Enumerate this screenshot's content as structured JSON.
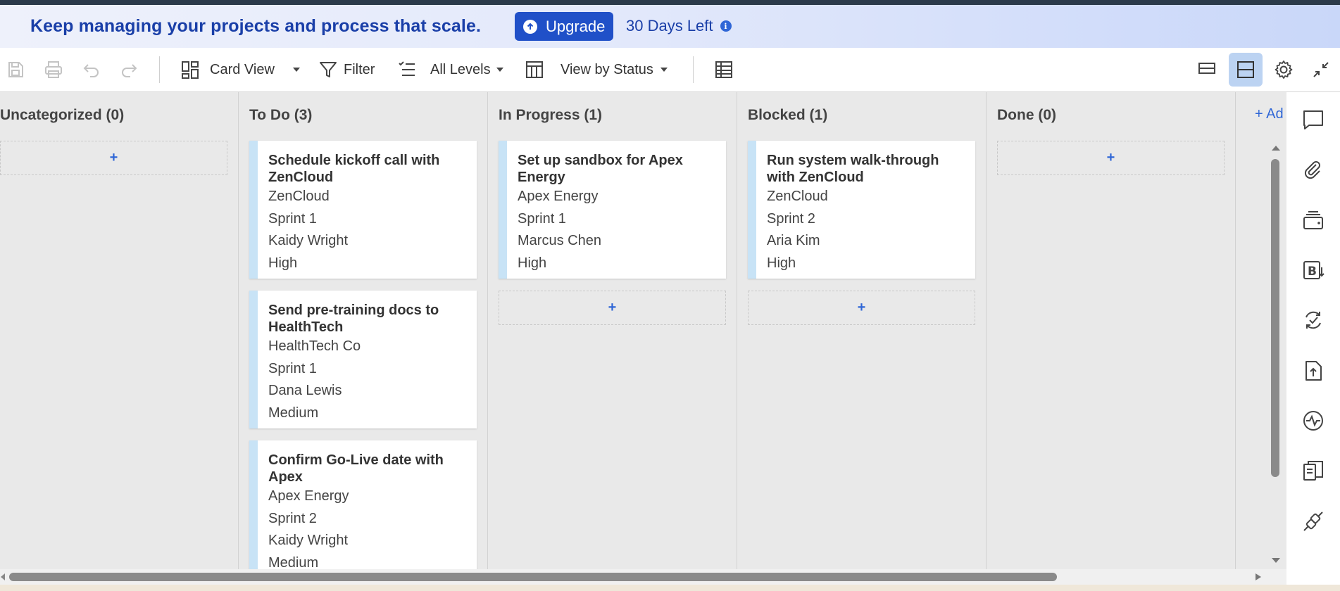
{
  "banner": {
    "message": "Keep managing your projects and process that scale.",
    "upgrade_label": "Upgrade",
    "days_left": "30 Days Left"
  },
  "toolbar": {
    "card_view_label": "Card View",
    "filter_label": "Filter",
    "levels_label": "All Levels",
    "view_by_label": "View by Status"
  },
  "board": {
    "add_column_label": "+ Ad",
    "add_card_label": "+",
    "columns": [
      {
        "title": "Uncategorized (0)",
        "cards": []
      },
      {
        "title": "To Do (3)",
        "cards": [
          {
            "title": "Schedule kickoff call with ZenCloud",
            "company": "ZenCloud",
            "sprint": "Sprint 1",
            "assignee": "Kaidy Wright",
            "priority": "High"
          },
          {
            "title": "Send pre-training docs to HealthTech",
            "company": "HealthTech Co",
            "sprint": "Sprint 1",
            "assignee": "Dana Lewis",
            "priority": "Medium"
          },
          {
            "title": "Confirm Go-Live date with Apex",
            "company": "Apex Energy",
            "sprint": "Sprint 2",
            "assignee": "Kaidy Wright",
            "priority": "Medium"
          }
        ]
      },
      {
        "title": "In Progress (1)",
        "cards": [
          {
            "title": "Set up sandbox for Apex Energy",
            "company": "Apex Energy",
            "sprint": "Sprint 1",
            "assignee": "Marcus Chen",
            "priority": "High"
          }
        ]
      },
      {
        "title": "Blocked (1)",
        "cards": [
          {
            "title": "Run system walk-through with ZenCloud",
            "company": "ZenCloud",
            "sprint": "Sprint 2",
            "assignee": "Aria Kim",
            "priority": "High"
          }
        ]
      },
      {
        "title": "Done (0)",
        "cards": []
      }
    ]
  },
  "colors": {
    "accent": "#2050c8",
    "card_stripe": "#c8e3f6",
    "banner_text": "#1a3fa8"
  }
}
